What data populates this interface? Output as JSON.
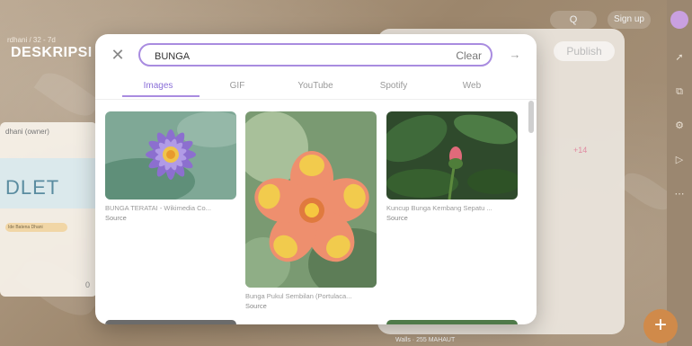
{
  "background": {
    "breadcrumb": "rdhani / 32 - 7d",
    "title": "DESKRIPSI",
    "top_search_label": "Q",
    "sign_up_label": "Sign up",
    "publish_label": "Publish",
    "extra_count": "+14",
    "left_card": {
      "owner": "dhani (owner)",
      "logo_text": "DLET",
      "chip_text": "Ide Batena Dhani",
      "comment_count": "0"
    },
    "fab_label": "+",
    "bottom_text": "Walls  ·  255 MAHAUT"
  },
  "modal": {
    "search": {
      "value": "BUNGA",
      "placeholder": "Search",
      "clear_label": "Clear"
    },
    "tabs": [
      {
        "label": "Images",
        "active": true
      },
      {
        "label": "GIF",
        "active": false
      },
      {
        "label": "YouTube",
        "active": false
      },
      {
        "label": "Spotify",
        "active": false
      },
      {
        "label": "Web",
        "active": false
      }
    ],
    "results": [
      {
        "caption": "BUNGA TERATAI - Wikimedia Co...",
        "source": "Source"
      },
      {
        "caption": "Bunga Pukul Sembilan (Portulaca...",
        "source": "Source"
      },
      {
        "caption": "Kuncup Bunga Kembang Sepatu ...",
        "source": "Source"
      }
    ]
  },
  "colors": {
    "accent": "#8a6fd8",
    "accent_border": "#a98ce0",
    "fab": "#d08a4a"
  }
}
